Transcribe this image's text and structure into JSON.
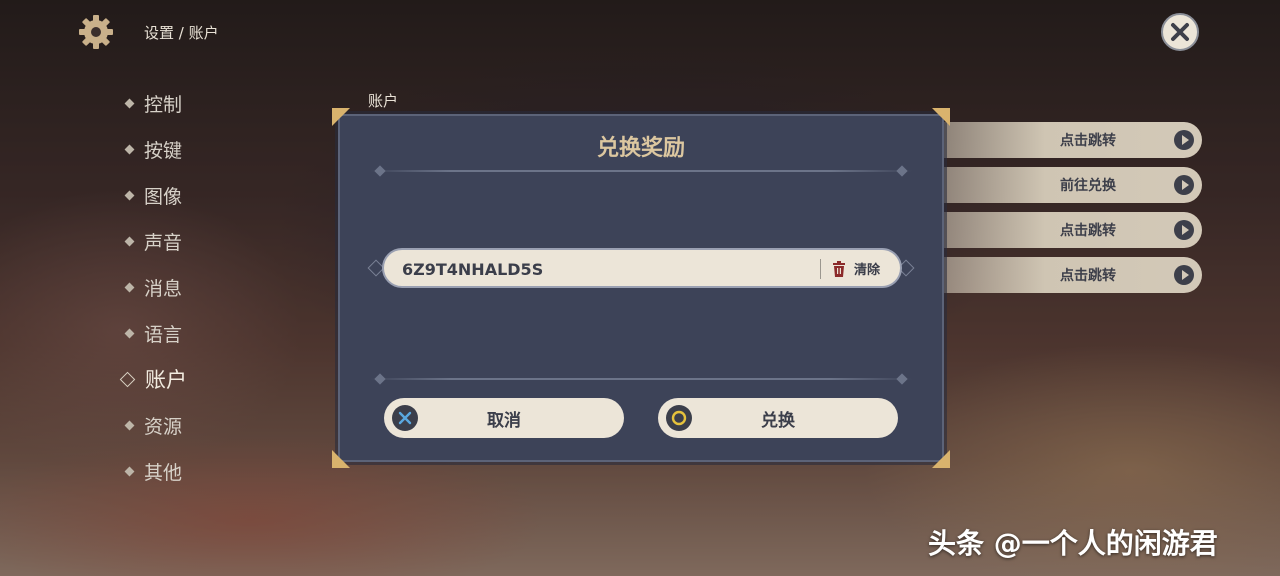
{
  "header": {
    "breadcrumb": "设置 / 账户",
    "icon": "gear-icon"
  },
  "sidebar": {
    "items": [
      {
        "label": "控制"
      },
      {
        "label": "按键"
      },
      {
        "label": "图像"
      },
      {
        "label": "声音"
      },
      {
        "label": "消息"
      },
      {
        "label": "语言"
      },
      {
        "label": "账户",
        "active": true
      },
      {
        "label": "资源"
      },
      {
        "label": "其他"
      }
    ]
  },
  "section": {
    "title": "账户"
  },
  "right_actions": [
    "点击跳转",
    "前往兑换",
    "点击跳转",
    "点击跳转"
  ],
  "dialog": {
    "title": "兑换奖励",
    "code_value": "6Z9T4NHALD5S",
    "clear_label": "清除",
    "cancel_label": "取消",
    "confirm_label": "兑换"
  },
  "watermark": "头条 @一个人的闲游君",
  "colors": {
    "dialog_bg": "#3d4358",
    "title_gold": "#dcc7a0",
    "corner_gold": "#d9b36d",
    "button_bg": "#ece5d8",
    "clear_icon_red": "#8b2a2a",
    "cancel_icon_blue": "#5aa8e0",
    "confirm_icon_yellow": "#e6c23c"
  }
}
